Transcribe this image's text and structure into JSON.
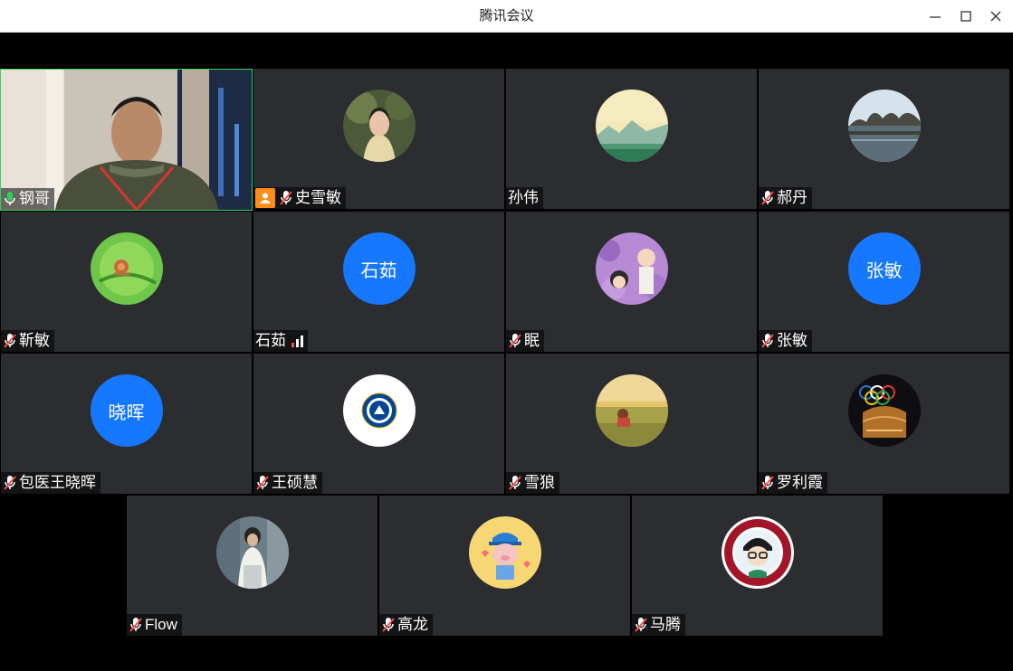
{
  "window": {
    "title": "腾讯会议"
  },
  "colors": {
    "active_speaker": "#2fd25a",
    "text_avatar": "#1677ff",
    "host_badge": "#ff8c1a",
    "muted": "#ff4d4f"
  },
  "participants": [
    {
      "name": "钢哥",
      "mic": "active",
      "avatar": "camera-video"
    },
    {
      "name": "史雪敏",
      "mic": "muted",
      "avatar": "photo-woman",
      "host": true
    },
    {
      "name": "孙伟",
      "mic": "none",
      "avatar": "landscape-mountains"
    },
    {
      "name": "郝丹",
      "mic": "muted",
      "avatar": "lake-trees"
    },
    {
      "name": "靳敏",
      "mic": "muted",
      "avatar": "green-snail"
    },
    {
      "name": "石茹",
      "mic": "signal",
      "avatar_text": "石茹"
    },
    {
      "name": "眠",
      "mic": "muted",
      "avatar": "cartoon-hydrangea"
    },
    {
      "name": "张敏",
      "mic": "muted",
      "avatar_text": "张敏"
    },
    {
      "name": "包医王晓晖",
      "mic": "muted",
      "avatar_text": "晓晖"
    },
    {
      "name": "王硕慧",
      "mic": "muted",
      "avatar": "chelsea-badge"
    },
    {
      "name": "雪狼",
      "mic": "muted",
      "avatar": "grassland-photo"
    },
    {
      "name": "罗利霞",
      "mic": "muted",
      "avatar": "olympic-rings-stadium"
    },
    {
      "name": "Flow",
      "mic": "muted",
      "avatar": "photo-person"
    },
    {
      "name": "高龙",
      "mic": "muted",
      "avatar": "cartoon-pig"
    },
    {
      "name": "马腾",
      "mic": "muted",
      "avatar": "peking-university-badge"
    }
  ]
}
